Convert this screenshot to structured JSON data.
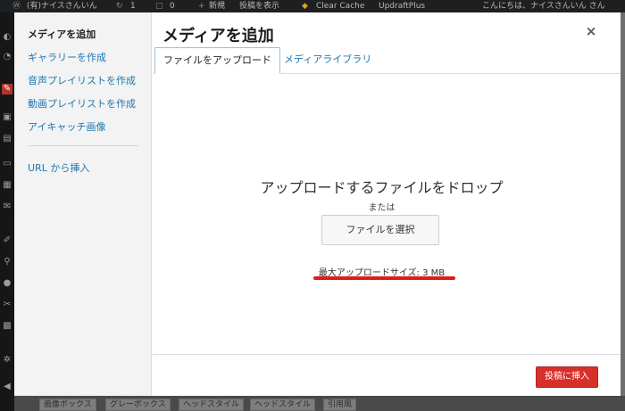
{
  "admin_bar": {
    "site_name": "(有)ナイスさんいん",
    "updates_count": "1",
    "comments_count": "0",
    "new_label": "新規",
    "view_post_label": "投稿を表示",
    "clear_cache_label": "Clear Cache",
    "updraftplus_label": "UpdraftPlus",
    "greeting": "こんにちは、ナイスさんいん さん"
  },
  "sidebar": {
    "items": [
      {
        "label": "メディアを追加",
        "current": true
      },
      {
        "label": "ギャラリーを作成"
      },
      {
        "label": "音声プレイリストを作成"
      },
      {
        "label": "動画プレイリストを作成"
      },
      {
        "label": "アイキャッチ画像"
      },
      {
        "label": "URL から挿入"
      }
    ]
  },
  "modal": {
    "title": "メディアを追加",
    "close_label": "×",
    "tabs": [
      {
        "label": "ファイルをアップロード",
        "active": true
      },
      {
        "label": "メディアライブラリ"
      }
    ],
    "upload": {
      "drop_title": "アップロードするファイルをドロップ",
      "or_text": "または",
      "select_button": "ファイルを選択",
      "max_size": "最大アップロードサイズ: 3 MB"
    },
    "insert_button": "投稿に挿入"
  },
  "bottom_tabs": [
    "画像ボックス",
    "グレーボックス",
    "ヘッドスタイル",
    "ヘッドスタイル",
    "引用風"
  ],
  "colors": {
    "accent_link": "#1e77b3",
    "insert_button": "#d7302a",
    "underline_annotation": "#e01b1b",
    "adminbar_bg": "#1d1f21",
    "overlay": "#6f6f6f"
  },
  "icons": {
    "adminbar": [
      "wordpress-logo-icon",
      "refresh-icon",
      "comment-icon",
      "plus-icon",
      "wordfence-icon"
    ],
    "adminmenu": [
      "dashboard-icon",
      "pin-icon",
      "media-icon",
      "pages-icon",
      "comments-icon",
      "appearance-icon",
      "plugins-icon",
      "users-icon",
      "tools-icon",
      "settings-icon",
      "collapse-icon"
    ]
  }
}
